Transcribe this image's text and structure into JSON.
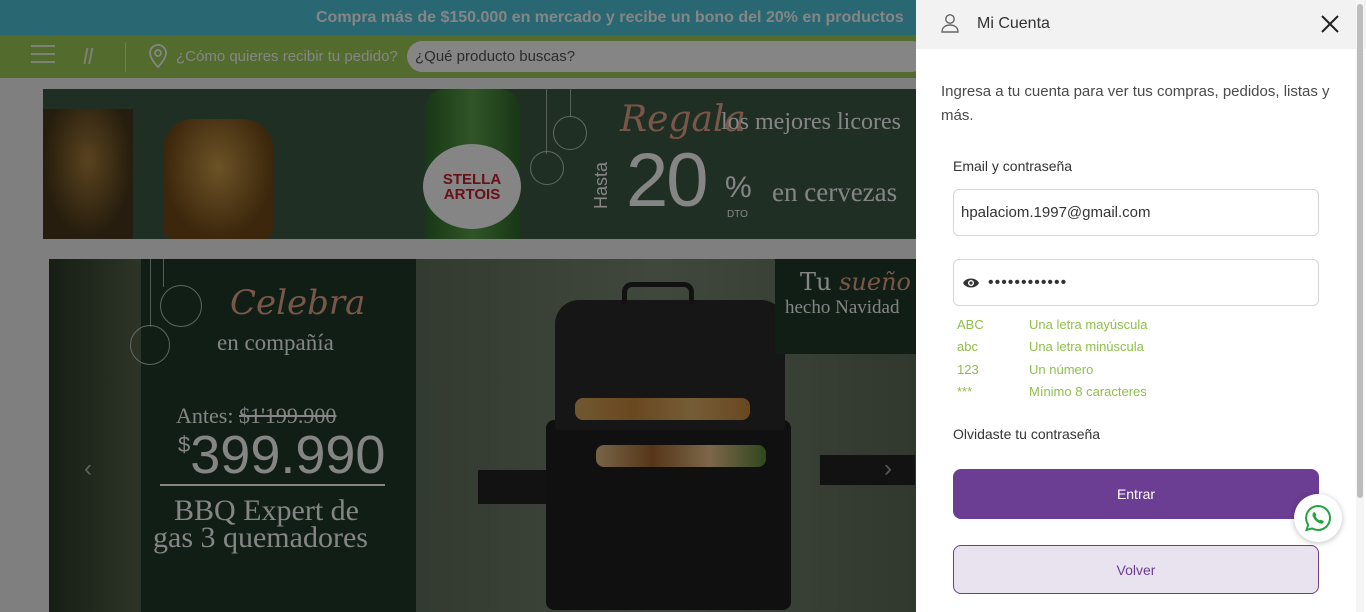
{
  "promo": {
    "text": "Compra más de $150.000 en mercado y recibe un bono del 20% en productos"
  },
  "nav": {
    "delivery_text": "¿Cómo quieres recibir tu pedido?",
    "search_placeholder": "¿Qué producto buscas?"
  },
  "banner_top": {
    "brand_line1": "STELLA",
    "brand_line2": "ARTOIS",
    "regala": "Regala",
    "mejores": "los mejores licores",
    "hasta": "Hasta",
    "percent": "20",
    "percent_sign": "%",
    "dto": "DTO",
    "cervezas": "en cervezas"
  },
  "banner_main": {
    "celebra": "Celebra",
    "compania": "en compañía",
    "antes_label": "Antes:",
    "antes_price": "$1'199.900",
    "price_symbol": "$",
    "price": "399.990",
    "product_line1": "BBQ Expert de",
    "product_line2": "gas 3 quemadores",
    "sueno_prefix": "Tu",
    "sueno_word": "sueño",
    "hecho": "hecho Navidad",
    "prev_arrow": "‹",
    "next_arrow": "›"
  },
  "drawer": {
    "title": "Mi Cuenta",
    "intro": "Ingresa a tu cuenta para ver tus compras, pedidos, listas y más.",
    "field_label": "Email y contraseña",
    "email_value": "hpalaciom.1997@gmail.com",
    "password_value": "••••••••••••",
    "rules": [
      {
        "code": "ABC",
        "text": "Una letra mayúscula"
      },
      {
        "code": "abc",
        "text": "Una letra minúscula"
      },
      {
        "code": "123",
        "text": "Un número"
      },
      {
        "code": "***",
        "text": "Mínimo 8 caracteres"
      }
    ],
    "forgot": "Olvidaste tu contraseña",
    "enter_button": "Entrar",
    "back_button": "Volver"
  },
  "colors": {
    "promo_bar": "#4fc7dc",
    "nav_bar": "#9fcf56",
    "primary_button": "#6b3d93",
    "rule_text": "#8fbf4a"
  },
  "icons": [
    "menu-icon",
    "brand-icon",
    "location-pin-icon",
    "user-icon",
    "close-icon",
    "eye-icon",
    "whatsapp-icon"
  ]
}
